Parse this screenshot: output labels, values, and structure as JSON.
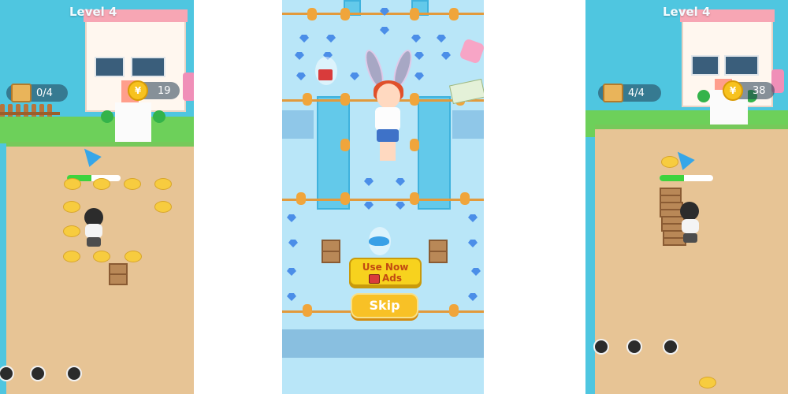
{
  "left": {
    "level_label": "Level 4",
    "boxes_counter": "0/4",
    "coins_counter": "19",
    "coin_symbol": "¥",
    "health_fraction": 0.45
  },
  "center": {
    "ads_button_line1": "Use Now",
    "ads_button_line2": "Ads",
    "skip_button": "Skip"
  },
  "right": {
    "level_label": "Level 4",
    "boxes_counter": "4/4",
    "coins_counter": "38",
    "coin_symbol": "¥",
    "health_fraction": 0.45
  },
  "colors": {
    "sky_water": "#4fc6e0",
    "ground_sand": "#e7c495",
    "grass": "#76c95a",
    "coin_yellow": "#f7c21e",
    "button_yellow": "#f7d21e"
  }
}
